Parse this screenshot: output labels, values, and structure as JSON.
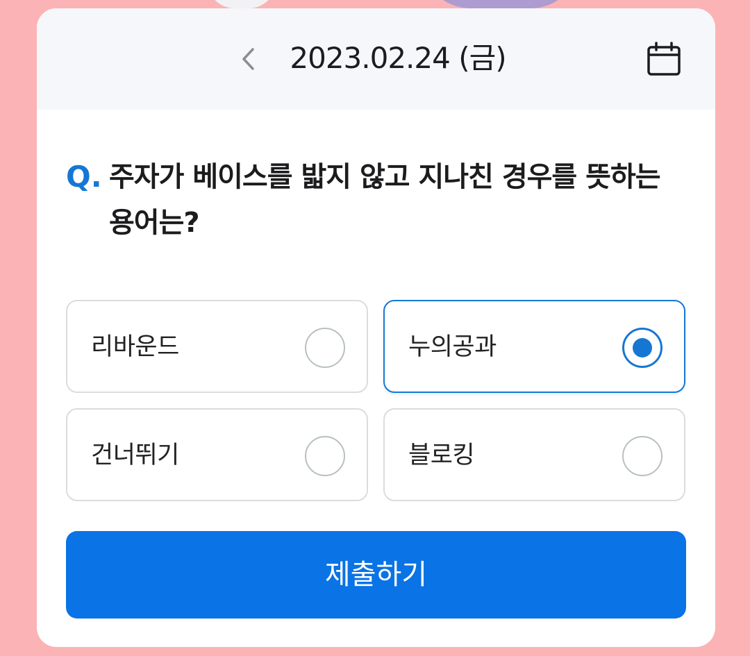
{
  "header": {
    "date": "2023.02.24 (금)",
    "prev_icon": "chevron-left-icon",
    "calendar_icon": "calendar-icon"
  },
  "question": {
    "marker": "Q.",
    "text": "주자가 베이스를 밟지 않고 지나친 경우를 뜻하는 용어는?"
  },
  "options": [
    {
      "label": "리바운드",
      "selected": false
    },
    {
      "label": "누의공과",
      "selected": true
    },
    {
      "label": "건너뛰기",
      "selected": false
    },
    {
      "label": "블로킹",
      "selected": false
    }
  ],
  "submit": {
    "label": "제출하기"
  },
  "colors": {
    "accent": "#1577d3",
    "button": "#0a73e5",
    "background": "#fbb3b5"
  }
}
